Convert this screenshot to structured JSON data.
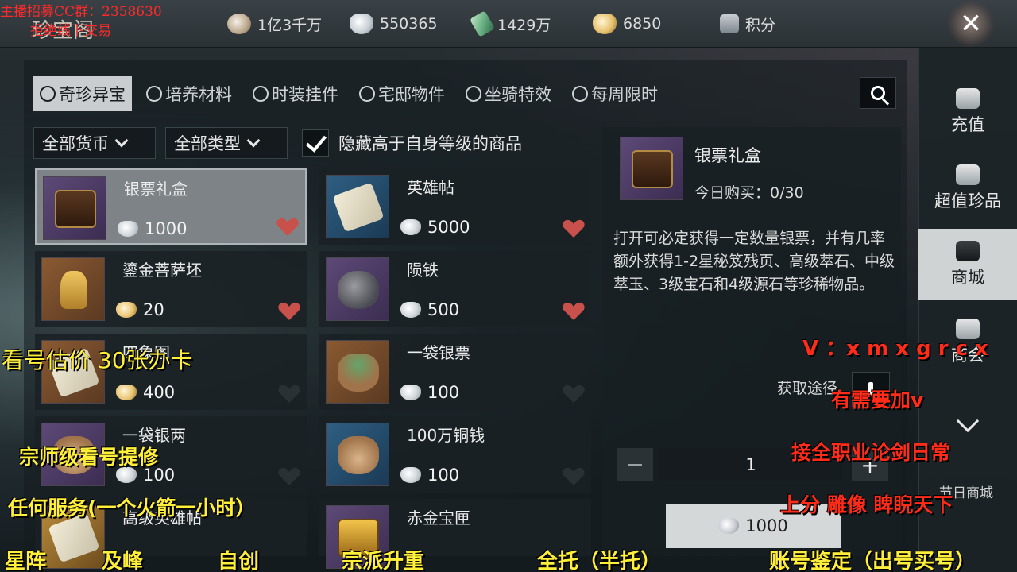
{
  "topbar": {
    "title": "珍宝阁",
    "currencies": [
      {
        "icon": "coin-icon",
        "value": "1亿3千万"
      },
      {
        "icon": "silver-ticket-icon",
        "value": "550365"
      },
      {
        "icon": "jade-icon",
        "value": "1429万"
      },
      {
        "icon": "gold-ingot-icon",
        "value": "6850"
      }
    ],
    "score_label": "积分",
    "close_label": "✕"
  },
  "tabs": [
    {
      "label": "奇珍异宝",
      "active": true
    },
    {
      "label": "培养材料"
    },
    {
      "label": "时装挂件"
    },
    {
      "label": "宅邸物件"
    },
    {
      "label": "坐骑特效"
    },
    {
      "label": "每周限时"
    }
  ],
  "filters": {
    "currency": "全部货币",
    "type": "全部类型",
    "hide_higher_level": "隐藏高于自身等级的商品",
    "hide_checked": true
  },
  "items": [
    {
      "name": "银票礼盒",
      "price": "1000",
      "currency": "silver",
      "favorited": true,
      "thumb": "chest",
      "bg": "purple",
      "selected": true
    },
    {
      "name": "英雄帖",
      "price": "5000",
      "currency": "silver",
      "favorited": true,
      "thumb": "scroll",
      "bg": "blue"
    },
    {
      "name": "鎏金菩萨坯",
      "price": "20",
      "currency": "gold",
      "favorited": true,
      "thumb": "statue",
      "bg": "brown"
    },
    {
      "name": "陨铁",
      "price": "500",
      "currency": "silver",
      "favorited": true,
      "thumb": "rock",
      "bg": "purple"
    },
    {
      "name": "四象图",
      "price": "400",
      "currency": "gold",
      "favorited": false,
      "thumb": "scroll",
      "bg": "brown"
    },
    {
      "name": "一袋银票",
      "price": "100",
      "currency": "silver",
      "favorited": false,
      "thumb": "bag-green",
      "bg": "brown"
    },
    {
      "name": "一袋银两",
      "price": "100",
      "currency": "silver",
      "favorited": false,
      "thumb": "bag",
      "bg": "purple"
    },
    {
      "name": "100万铜钱",
      "price": "100",
      "currency": "silver",
      "favorited": false,
      "thumb": "bag",
      "bg": "blue"
    },
    {
      "name": "高级英雄帖",
      "price": "",
      "currency": "silver",
      "favorited": false,
      "thumb": "scroll",
      "bg": "gold"
    },
    {
      "name": "赤金宝匣",
      "price": "",
      "currency": "silver",
      "favorited": false,
      "thumb": "goldbox",
      "bg": "purple"
    }
  ],
  "detail": {
    "name": "银票礼盒",
    "limit": "今日购买：0/30",
    "description": "打开可必定获得一定数量银票，并有几率额外获得1-2星秘笈残页、高级萃石、中级萃玉、3级宝石和4级源石等珍稀物品。",
    "source_label": "获取途径",
    "quantity": "1",
    "buy_price": "1000"
  },
  "sidenav": [
    {
      "label": "充值",
      "icon": "recharge-icon"
    },
    {
      "label": "超值珍品",
      "icon": "treasure-icon"
    },
    {
      "label": "商城",
      "icon": "mall-icon",
      "active": true
    },
    {
      "label": "商会",
      "icon": "guild-icon"
    }
  ],
  "sidenav_bottom": "节日商城",
  "overlays": {
    "tl_line1": "主播招募CC群：2358630",
    "tl_line2": "拒绝线下交易",
    "left1": "看号估价  30张办卡",
    "left2": "宗师级看号提修",
    "left3": "任何服务(一个火箭一小时）",
    "right1": "V ：x m x g r c x",
    "right2": "有需要加v",
    "right3": "接全职业论剑日常",
    "right4": "上分   雕像   睥睨天下",
    "bottom": [
      "星阵",
      "及峰",
      "自创",
      "宗派升重",
      "全托（半托）",
      "账号鉴定（出号买号）"
    ]
  },
  "colors": {
    "accent_red": "#ff2c1a",
    "accent_yellow": "#ffef3a",
    "heart": "#c9514b"
  }
}
